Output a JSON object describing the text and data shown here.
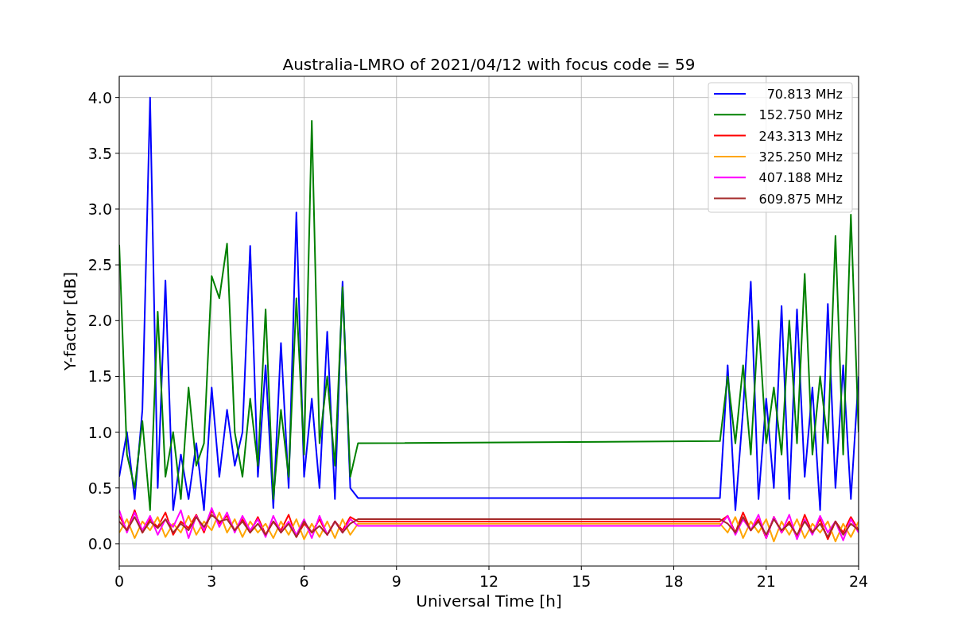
{
  "figure": {
    "chart_data": {
      "type": "line",
      "title": "Australia-LMRO of 2021/04/12 with focus code = 59",
      "xlabel": "Universal Time [h]",
      "ylabel": "Y-factor [dB]",
      "x": [
        0,
        0.25,
        0.5,
        0.75,
        1,
        1.25,
        1.5,
        1.75,
        2,
        2.25,
        2.5,
        2.75,
        3,
        3.25,
        3.5,
        3.75,
        4,
        4.25,
        4.5,
        4.75,
        5,
        5.25,
        5.5,
        5.75,
        6,
        6.25,
        6.5,
        6.75,
        7,
        7.25,
        7.5,
        7.75,
        19.5,
        19.75,
        20,
        20.25,
        20.5,
        20.75,
        21,
        21.25,
        21.5,
        21.75,
        22,
        22.25,
        22.5,
        22.75,
        23,
        23.25,
        23.5,
        23.75,
        24
      ],
      "series": [
        {
          "name": "70.813 MHz",
          "color": "#0000ff",
          "values": [
            0.6,
            1.0,
            0.4,
            1.2,
            4.0,
            0.5,
            2.36,
            0.3,
            0.8,
            0.4,
            0.9,
            0.3,
            1.4,
            0.6,
            1.2,
            0.7,
            1.0,
            2.67,
            0.6,
            1.6,
            0.32,
            1.8,
            0.5,
            2.97,
            0.6,
            1.3,
            0.5,
            1.9,
            0.4,
            2.35,
            0.5,
            0.41,
            0.41,
            1.6,
            0.3,
            1.2,
            2.35,
            0.4,
            1.3,
            0.5,
            2.13,
            0.4,
            2.1,
            0.6,
            1.4,
            0.3,
            2.15,
            0.5,
            1.6,
            0.4,
            1.5
          ]
        },
        {
          "name": "152.750 MHz",
          "color": "#008000",
          "values": [
            2.68,
            0.8,
            0.5,
            1.1,
            0.3,
            2.08,
            0.6,
            1.0,
            0.4,
            1.4,
            0.7,
            0.9,
            2.4,
            2.2,
            2.69,
            1.0,
            0.6,
            1.3,
            0.7,
            2.1,
            0.4,
            1.2,
            0.6,
            2.2,
            0.8,
            3.79,
            0.9,
            1.5,
            0.7,
            2.3,
            0.6,
            0.9,
            0.92,
            1.5,
            0.9,
            1.6,
            0.8,
            2.0,
            0.9,
            1.4,
            0.8,
            2.0,
            0.9,
            2.42,
            0.8,
            1.5,
            0.9,
            2.76,
            0.8,
            2.95,
            1.0
          ]
        },
        {
          "name": "243.313 MHz",
          "color": "#ff0000",
          "values": [
            0.25,
            0.12,
            0.3,
            0.1,
            0.22,
            0.15,
            0.28,
            0.08,
            0.2,
            0.14,
            0.26,
            0.1,
            0.3,
            0.18,
            0.25,
            0.12,
            0.22,
            0.1,
            0.24,
            0.08,
            0.2,
            0.12,
            0.26,
            0.06,
            0.18,
            0.1,
            0.22,
            0.08,
            0.2,
            0.12,
            0.24,
            0.2,
            0.2,
            0.25,
            0.1,
            0.28,
            0.12,
            0.22,
            0.05,
            0.24,
            0.1,
            0.2,
            0.06,
            0.26,
            0.1,
            0.22,
            0.04,
            0.2,
            0.1,
            0.24,
            0.12
          ]
        },
        {
          "name": "325.250 MHz",
          "color": "#ffa500",
          "values": [
            0.1,
            0.22,
            0.05,
            0.2,
            0.12,
            0.24,
            0.06,
            0.18,
            0.1,
            0.25,
            0.08,
            0.2,
            0.12,
            0.28,
            0.1,
            0.22,
            0.06,
            0.2,
            0.1,
            0.18,
            0.05,
            0.2,
            0.08,
            0.22,
            0.04,
            0.18,
            0.06,
            0.2,
            0.05,
            0.22,
            0.08,
            0.18,
            0.18,
            0.1,
            0.24,
            0.05,
            0.2,
            0.1,
            0.22,
            0.02,
            0.2,
            0.08,
            0.22,
            0.05,
            0.18,
            0.1,
            0.2,
            0.02,
            0.18,
            0.06,
            0.2
          ]
        },
        {
          "name": "407.188 MHz",
          "color": "#ff00ff",
          "values": [
            0.3,
            0.1,
            0.28,
            0.12,
            0.25,
            0.08,
            0.22,
            0.15,
            0.3,
            0.05,
            0.25,
            0.12,
            0.32,
            0.15,
            0.28,
            0.1,
            0.25,
            0.12,
            0.22,
            0.06,
            0.25,
            0.1,
            0.2,
            0.08,
            0.22,
            0.05,
            0.25,
            0.08,
            0.2,
            0.1,
            0.22,
            0.16,
            0.16,
            0.25,
            0.08,
            0.22,
            0.12,
            0.26,
            0.05,
            0.24,
            0.1,
            0.26,
            0.04,
            0.22,
            0.08,
            0.25,
            0.1,
            0.2,
            0.03,
            0.22,
            0.1
          ]
        },
        {
          "name": "609.875 MHz",
          "color": "#a52a2a",
          "values": [
            0.2,
            0.12,
            0.24,
            0.1,
            0.2,
            0.14,
            0.22,
            0.1,
            0.18,
            0.12,
            0.24,
            0.15,
            0.26,
            0.2,
            0.22,
            0.12,
            0.2,
            0.1,
            0.18,
            0.08,
            0.2,
            0.1,
            0.18,
            0.06,
            0.2,
            0.1,
            0.16,
            0.08,
            0.2,
            0.1,
            0.18,
            0.22,
            0.22,
            0.18,
            0.1,
            0.24,
            0.12,
            0.2,
            0.08,
            0.22,
            0.12,
            0.18,
            0.08,
            0.2,
            0.1,
            0.18,
            0.06,
            0.2,
            0.08,
            0.18,
            0.12
          ]
        }
      ],
      "grid": true,
      "legend": true,
      "xlim": [
        0,
        24
      ],
      "ylim": [
        -0.2,
        4.19
      ],
      "xticks": [
        0,
        3,
        6,
        9,
        12,
        15,
        18,
        21,
        24
      ],
      "yticks": [
        {
          "value": 0,
          "label": "0.0"
        },
        {
          "value": 0.5,
          "label": "0.5"
        },
        {
          "value": 1,
          "label": "1.0"
        },
        {
          "value": 1.5,
          "label": "1.5"
        },
        {
          "value": 2,
          "label": "2.0"
        },
        {
          "value": 2.5,
          "label": "2.5"
        },
        {
          "value": 3,
          "label": "3.0"
        },
        {
          "value": 3.5,
          "label": "3.5"
        },
        {
          "value": 4,
          "label": "4.0"
        }
      ]
    }
  }
}
